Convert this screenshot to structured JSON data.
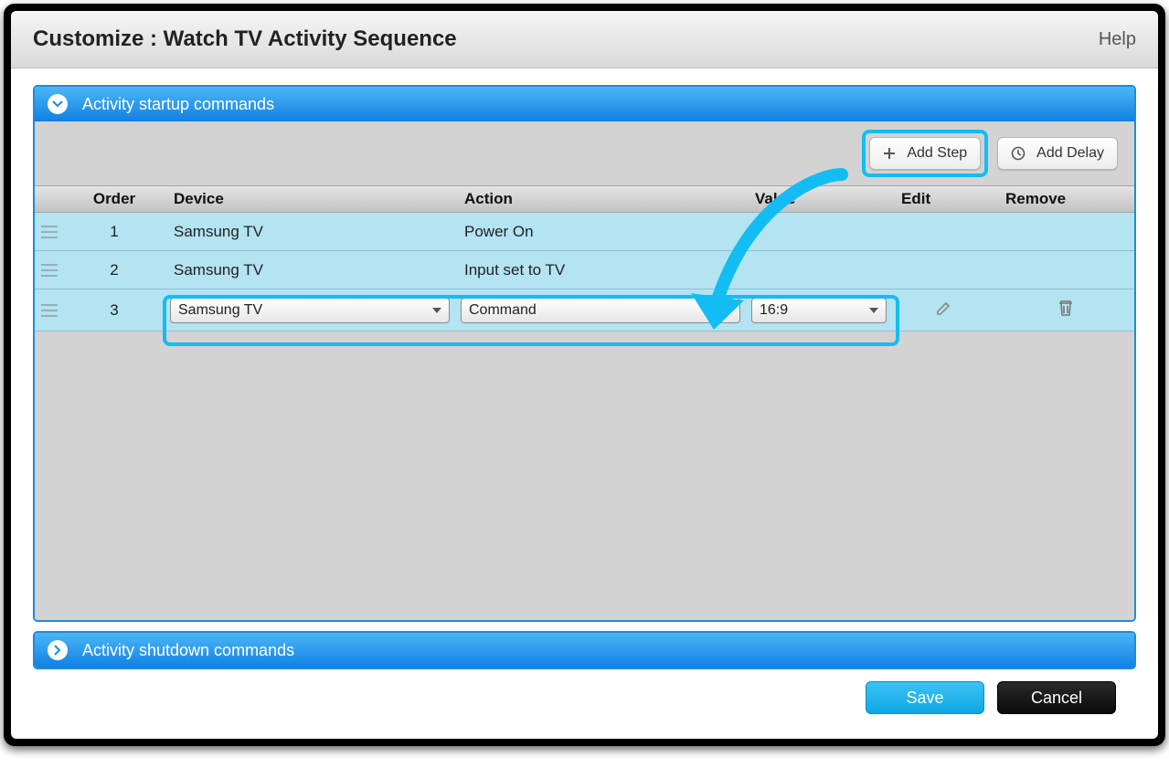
{
  "window": {
    "title": "Customize : Watch TV Activity Sequence",
    "help": "Help"
  },
  "startup": {
    "title": "Activity startup commands",
    "add_step": "Add Step",
    "add_delay": "Add Delay",
    "columns": {
      "order": "Order",
      "device": "Device",
      "action": "Action",
      "value": "Value",
      "edit": "Edit",
      "remove": "Remove"
    },
    "rows": [
      {
        "order": "1",
        "device": "Samsung TV",
        "action": "Power On",
        "value": "",
        "type": "static"
      },
      {
        "order": "2",
        "device": "Samsung TV",
        "action": "Input set to TV",
        "value": "",
        "type": "static"
      },
      {
        "order": "3",
        "device": "Samsung TV",
        "action": "Command",
        "value": "16:9",
        "type": "editable"
      }
    ]
  },
  "shutdown": {
    "title": "Activity shutdown commands"
  },
  "footer": {
    "save": "Save",
    "cancel": "Cancel"
  },
  "colors": {
    "accent": "#13bdf3",
    "header_blue": "#1b8be0"
  }
}
